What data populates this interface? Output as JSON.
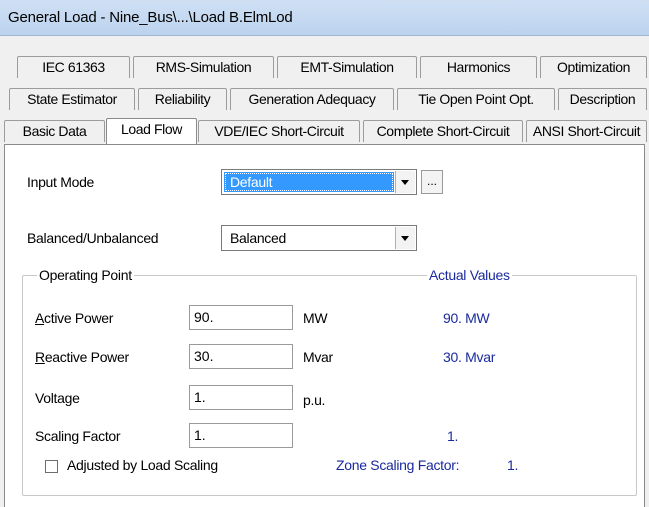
{
  "window": {
    "title": "General Load - Nine_Bus\\...\\Load B.ElmLod"
  },
  "tabs": {
    "row1": [
      "IEC 61363",
      "RMS-Simulation",
      "EMT-Simulation",
      "Harmonics",
      "Optimization"
    ],
    "row2": [
      "State Estimator",
      "Reliability",
      "Generation Adequacy",
      "Tie Open Point Opt.",
      "Description"
    ],
    "row3": [
      "Basic Data",
      "Load Flow",
      "VDE/IEC Short-Circuit",
      "Complete Short-Circuit",
      "ANSI Short-Circuit"
    ],
    "active": "Load Flow"
  },
  "form": {
    "input_mode_label": "Input Mode",
    "input_mode_value": "Default",
    "browse_label": "...",
    "balanced_label": "Balanced/Unbalanced",
    "balanced_value": "Balanced"
  },
  "operating_point": {
    "legend": "Operating Point",
    "actual_legend": "Actual Values",
    "active_power": {
      "label_first": "A",
      "label_rest": "ctive Power",
      "value": "90.",
      "unit": "MW",
      "actual": "90. MW"
    },
    "reactive_power": {
      "label_first": "R",
      "label_rest": "eactive Power",
      "value": "30.",
      "unit": "Mvar",
      "actual": "30. Mvar"
    },
    "voltage": {
      "label": "Voltage",
      "value": "1.",
      "unit": "p.u."
    },
    "scaling_factor": {
      "label": "Scaling Factor",
      "value": "1.",
      "actual": "1."
    },
    "adjusted_label": "Adjusted by Load Scaling",
    "zone_label": "Zone Scaling Factor:",
    "zone_value": "1."
  }
}
